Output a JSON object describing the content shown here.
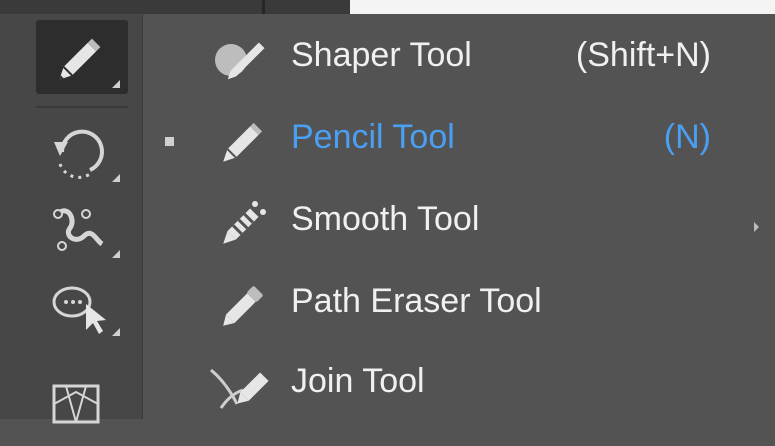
{
  "colors": {
    "background": "#535353",
    "toolbar": "#474747",
    "active_tool": "#2d2d2d",
    "text": "#f0f0f0",
    "selected_text": "#4b9ff2"
  },
  "toolbar": {
    "tools": [
      {
        "icon": "pencil-icon",
        "active": true
      },
      {
        "icon": "rotate-icon",
        "active": false
      },
      {
        "icon": "puppet-warp-icon",
        "active": false
      },
      {
        "icon": "shape-builder-icon",
        "active": false
      },
      {
        "icon": "perspective-grid-icon",
        "active": false
      }
    ]
  },
  "flyout": {
    "items": [
      {
        "label": "Shaper Tool",
        "shortcut": "(Shift+N)",
        "icon": "shaper-icon",
        "selected": false
      },
      {
        "label": "Pencil Tool",
        "shortcut": "(N)",
        "icon": "pencil-icon",
        "selected": true
      },
      {
        "label": "Smooth Tool",
        "shortcut": "",
        "icon": "smooth-icon",
        "selected": false
      },
      {
        "label": "Path Eraser Tool",
        "shortcut": "",
        "icon": "path-eraser-icon",
        "selected": false
      },
      {
        "label": "Join Tool",
        "shortcut": "",
        "icon": "join-icon",
        "selected": false
      }
    ]
  }
}
